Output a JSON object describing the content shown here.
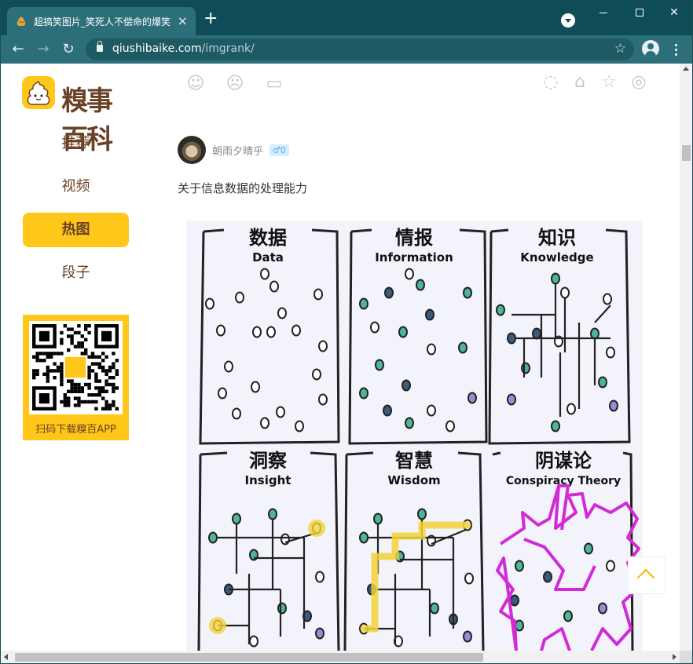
{
  "browser": {
    "tab_title": "超搞笑图片_笑死人不偿命的爆笑",
    "new_tab_label": "+",
    "url_host": "qiushibaike.com",
    "url_path": "/imgrank/"
  },
  "site": {
    "logo_text": "糗事百科",
    "nav": [
      "推荐",
      "视频",
      "热图",
      "段子"
    ],
    "active_nav": "热图",
    "qr_caption": "扫码下载糗百APP"
  },
  "post": {
    "author_name": "朝雨夕晴乎",
    "gender_badge": "♂0",
    "caption": "关于信息数据的处理能力",
    "comic_panels": [
      {
        "title_cn": "数据",
        "title_en": "Data"
      },
      {
        "title_cn": "情报",
        "title_en": "Information"
      },
      {
        "title_cn": "知识",
        "title_en": "Knowledge"
      },
      {
        "title_cn": "洞察",
        "title_en": "Insight"
      },
      {
        "title_cn": "智慧",
        "title_en": "Wisdom"
      },
      {
        "title_cn": "阴谋论",
        "title_en": "Conspiracy Theory"
      }
    ]
  },
  "colors": {
    "brand_yellow": "#ffc719",
    "brand_brown": "#6a4127",
    "browser_teal": "#0e4d57"
  }
}
